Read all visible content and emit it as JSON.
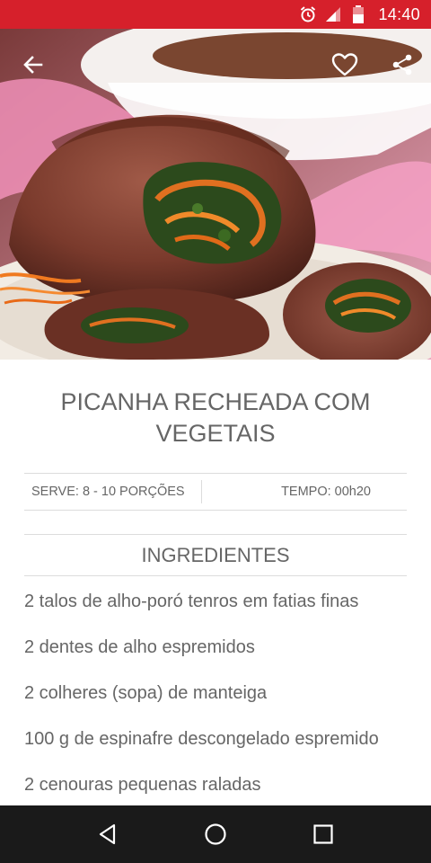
{
  "status_bar": {
    "time": "14:40",
    "icons": [
      "alarm-icon",
      "signal-icon",
      "battery-icon"
    ],
    "color": "#d6202b"
  },
  "toolbar": {
    "icons": [
      "back-arrow-icon",
      "heart-outline-icon",
      "share-icon"
    ]
  },
  "recipe": {
    "title": "PICANHA RECHEADA COM VEGETAIS",
    "serve": "SERVE: 8 - 10 PORÇÕES",
    "tempo": "TEMPO: 00h20"
  },
  "ingredients": {
    "header": "INGREDIENTES",
    "items": [
      "2 talos de alho-poró tenros em fatias finas",
      "2 dentes de alho espremidos",
      "2 colheres (sopa) de manteiga",
      "100 g de espinafre descongelado espremido",
      "2 cenouras pequenas raladas"
    ]
  },
  "nav_bar": {
    "icons": [
      "nav-back-icon",
      "nav-home-icon",
      "nav-recents-icon"
    ]
  }
}
